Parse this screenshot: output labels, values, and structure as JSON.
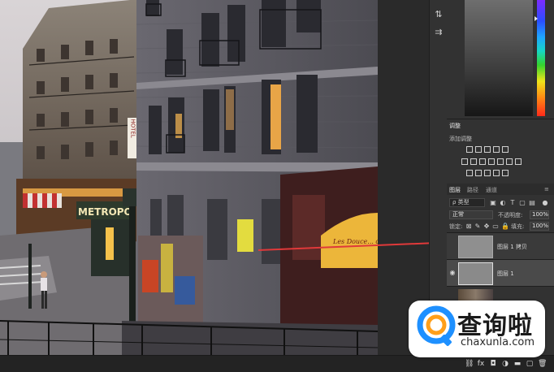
{
  "photo": {
    "sign_hotel": "HOTEL",
    "sign_metro": "METROPO",
    "sign_shop": "Les Douce... de Cenelli"
  },
  "adjustments": {
    "title": "调整",
    "subtitle": "添加调整"
  },
  "layers_panel": {
    "tabs": [
      "图层",
      "路径",
      "通道"
    ],
    "filter_label": "ρ 类型",
    "blend_mode": "正常",
    "opacity_label": "不透明度:",
    "opacity_value": "100%",
    "lock_label": "锁定:",
    "fill_label": "填充:",
    "fill_value": "100%",
    "layers": [
      {
        "name": "图层 1 拷贝"
      },
      {
        "name": "图层 1"
      }
    ]
  },
  "watermark": {
    "title": "查询啦",
    "url": "chaxunla.com"
  },
  "colors": {
    "panel_bg": "#323232",
    "arrow": "#e0393a",
    "accent_blue": "#1e90ff"
  }
}
